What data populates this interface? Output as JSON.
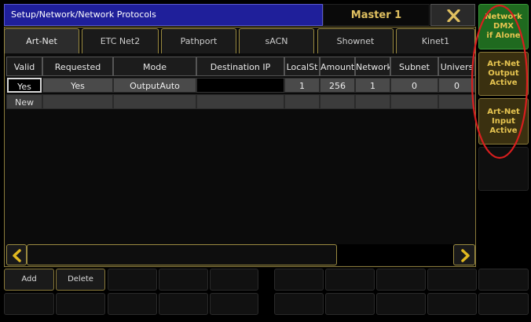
{
  "header": {
    "title": "Setup/Network/Network Protocols",
    "master_label": "Master 1",
    "close_glyph": "✕"
  },
  "tabs": [
    {
      "label": "Art-Net",
      "active": true
    },
    {
      "label": "ETC Net2"
    },
    {
      "label": "Pathport"
    },
    {
      "label": "sACN"
    },
    {
      "label": "Shownet"
    },
    {
      "label": "Kinet1"
    }
  ],
  "table": {
    "columns": [
      "Valid",
      "Requested",
      "Mode",
      "Destination IP",
      "LocalSt",
      "Amount",
      "Network",
      "Subnet",
      "Univers"
    ],
    "rows": [
      [
        "Yes",
        "Yes",
        "OutputAuto",
        "",
        "1",
        "256",
        "1",
        "0",
        "0"
      ],
      [
        "New",
        "",
        "",
        "",
        "",
        "",
        "",
        "",
        ""
      ]
    ]
  },
  "side_buttons": {
    "dmx": "Network\nDMX\nif Alone",
    "output": "Art-Net\nOutput\nActive",
    "input": "Art-Net\nInput\nActive"
  },
  "bottom": {
    "add_label": "Add",
    "delete_label": "Delete"
  },
  "colors": {
    "accent_gold": "#e0c060",
    "title_blue": "#1f1f9a",
    "dmx_green": "#1f6a1f",
    "annotation_red": "#d81e1e"
  }
}
